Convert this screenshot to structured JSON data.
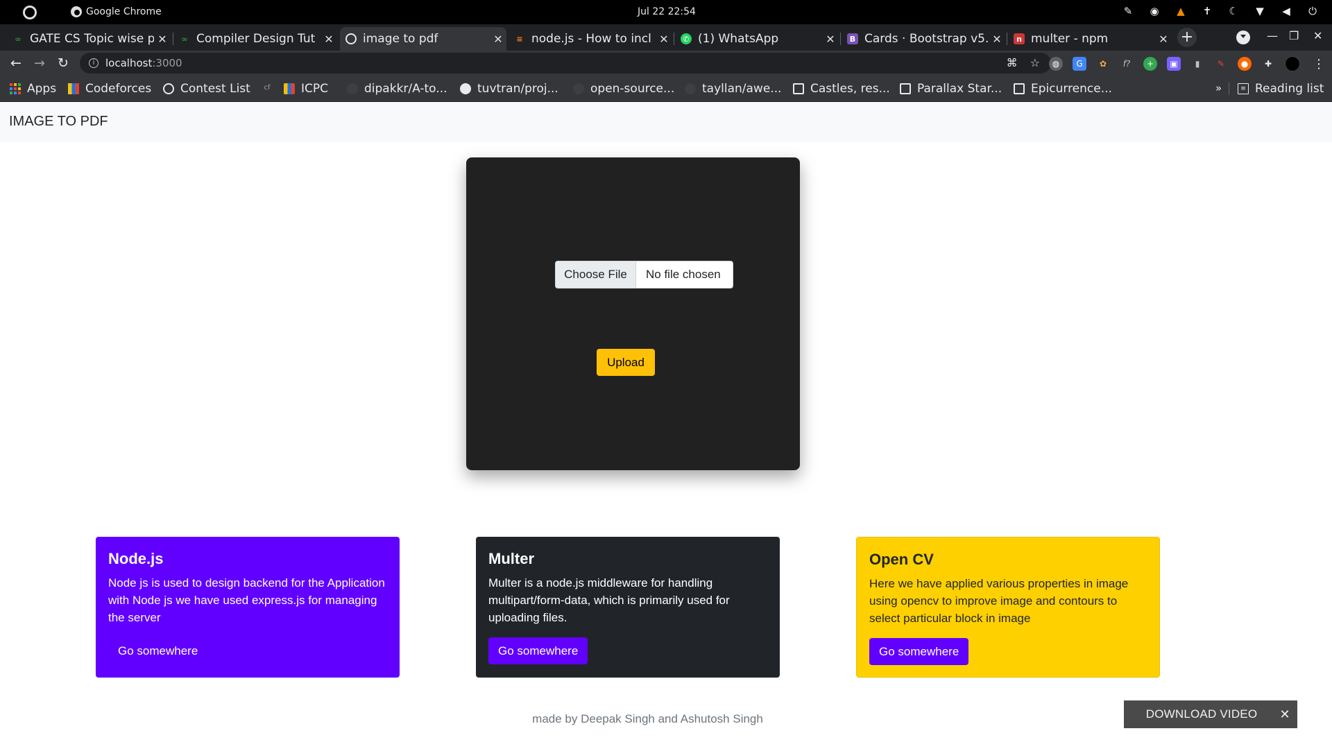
{
  "os": {
    "app_name": "Google Chrome",
    "clock": "Jul 22  22:54"
  },
  "tabs": [
    {
      "title": "GATE CS Topic wise p",
      "favicon": "gfg-icon",
      "active": false
    },
    {
      "title": "Compiler Design Tut",
      "favicon": "gfg-icon",
      "active": false
    },
    {
      "title": "image to pdf",
      "favicon": "globe-icon",
      "active": true
    },
    {
      "title": "node.js - How to incl",
      "favicon": "stackoverflow-icon",
      "active": false
    },
    {
      "title": "(1) WhatsApp",
      "favicon": "whatsapp-icon",
      "active": false
    },
    {
      "title": "Cards · Bootstrap v5.",
      "favicon": "bootstrap-icon",
      "active": false
    },
    {
      "title": "multer - npm",
      "favicon": "npm-icon",
      "active": false
    }
  ],
  "address": {
    "host": "localhost",
    "port": ":3000"
  },
  "bookmarks": [
    {
      "label": "Apps",
      "icon": "apps-grid-icon"
    },
    {
      "label": "Codeforces",
      "icon": "codeforces-icon"
    },
    {
      "label": "Contest List",
      "icon": "globe-icon"
    },
    {
      "label": "",
      "icon": "cf-small-icon"
    },
    {
      "label": "ICPC",
      "icon": "icpc-icon"
    },
    {
      "label": "dipakkr/A-to...",
      "icon": "github-icon"
    },
    {
      "label": "tuvtran/proj...",
      "icon": "github-icon"
    },
    {
      "label": "open-source...",
      "icon": "github-icon"
    },
    {
      "label": "tayllan/awe...",
      "icon": "github-icon"
    },
    {
      "label": "Castles, res...",
      "icon": "codepen-icon"
    },
    {
      "label": "Parallax Star...",
      "icon": "codepen-icon"
    },
    {
      "label": "Epicurrence...",
      "icon": "codepen-icon"
    }
  ],
  "bookmarks_overflow": "»",
  "reading_list": "Reading list",
  "page": {
    "brand": "IMAGE TO PDF",
    "choose_file": "Choose File",
    "file_status": "No file chosen",
    "upload": "Upload",
    "cards": [
      {
        "title": "Node.js",
        "text": "Node js is used to design backend for the Application with Node js we have used express.js for managing the server",
        "link": "Go somewhere"
      },
      {
        "title": "Multer",
        "text": "Multer is a node.js middleware for handling multipart/form-data, which is primarily used for uploading files.",
        "link": "Go somewhere"
      },
      {
        "title": "Open CV",
        "text": "Here we have applied various properties in image using opencv to improve image and contours to select particular block in image",
        "link": "Go somewhere"
      }
    ],
    "footer": "made by Deepak Singh and Ashutosh Singh"
  },
  "download_video": {
    "label": "DOWNLOAD VIDEO",
    "close": "✕"
  },
  "colors": {
    "card_purple": "#6200ff",
    "card_dark": "#212529",
    "card_yellow": "#ffd000",
    "upload_button": "#ffc107"
  }
}
